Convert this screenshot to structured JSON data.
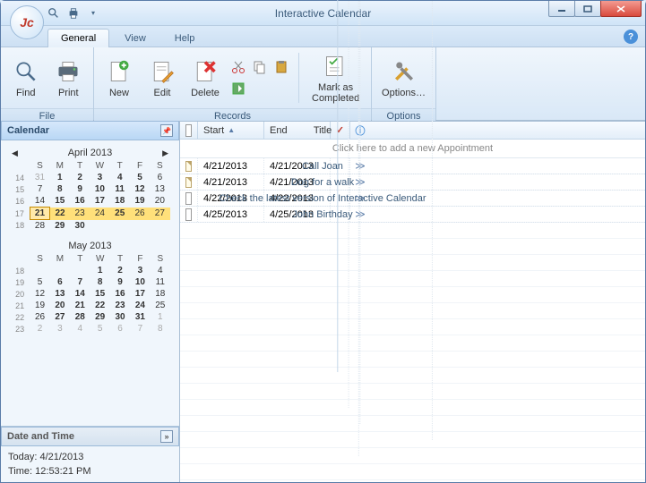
{
  "app_icon_text": "Jc",
  "window_title": "Interactive Calendar",
  "qat": {
    "search": "search-icon",
    "print": "print-icon",
    "dropdown": "chevron-down-icon"
  },
  "tabs": {
    "general": "General",
    "view": "View",
    "help": "Help"
  },
  "ribbon": {
    "file": {
      "label": "File",
      "find": "Find",
      "print": "Print"
    },
    "records": {
      "label": "Records",
      "new": "New",
      "edit": "Edit",
      "delete": "Delete",
      "mark": "Mark as\nCompleted"
    },
    "options": {
      "label": "Options",
      "options": "Options…"
    }
  },
  "left": {
    "calendar_title": "Calendar",
    "cal1": {
      "title": "April 2013",
      "dow": [
        "S",
        "M",
        "T",
        "W",
        "T",
        "F",
        "S"
      ],
      "weeks": [
        {
          "wk": "14",
          "days": [
            {
              "d": "31",
              "dim": true
            },
            {
              "d": "1",
              "bold": true
            },
            {
              "d": "2",
              "bold": true
            },
            {
              "d": "3",
              "bold": true
            },
            {
              "d": "4",
              "bold": true
            },
            {
              "d": "5",
              "bold": true
            },
            {
              "d": "6"
            }
          ]
        },
        {
          "wk": "15",
          "days": [
            {
              "d": "7"
            },
            {
              "d": "8",
              "bold": true
            },
            {
              "d": "9",
              "bold": true
            },
            {
              "d": "10",
              "bold": true
            },
            {
              "d": "11",
              "bold": true
            },
            {
              "d": "12",
              "bold": true
            },
            {
              "d": "13"
            }
          ]
        },
        {
          "wk": "16",
          "days": [
            {
              "d": "14"
            },
            {
              "d": "15",
              "bold": true
            },
            {
              "d": "16",
              "bold": true
            },
            {
              "d": "17",
              "bold": true
            },
            {
              "d": "18",
              "bold": true
            },
            {
              "d": "19",
              "bold": true
            },
            {
              "d": "20"
            }
          ]
        },
        {
          "wk": "17",
          "days": [
            {
              "d": "21",
              "today": true
            },
            {
              "d": "22",
              "sel": true,
              "bold": true
            },
            {
              "d": "23",
              "sel": true
            },
            {
              "d": "24",
              "sel": true
            },
            {
              "d": "25",
              "sel": true,
              "bold": true
            },
            {
              "d": "26",
              "sel": true
            },
            {
              "d": "27",
              "sel": true
            }
          ]
        },
        {
          "wk": "18",
          "days": [
            {
              "d": "28"
            },
            {
              "d": "29",
              "bold": true
            },
            {
              "d": "30",
              "bold": true
            },
            {
              "d": ""
            },
            {
              "d": ""
            },
            {
              "d": ""
            },
            {
              "d": ""
            }
          ]
        }
      ]
    },
    "cal2": {
      "title": "May 2013",
      "dow": [
        "S",
        "M",
        "T",
        "W",
        "T",
        "F",
        "S"
      ],
      "weeks": [
        {
          "wk": "18",
          "days": [
            {
              "d": ""
            },
            {
              "d": ""
            },
            {
              "d": ""
            },
            {
              "d": "1",
              "bold": true
            },
            {
              "d": "2",
              "bold": true
            },
            {
              "d": "3",
              "bold": true
            },
            {
              "d": "4"
            }
          ]
        },
        {
          "wk": "19",
          "days": [
            {
              "d": "5"
            },
            {
              "d": "6",
              "bold": true
            },
            {
              "d": "7",
              "bold": true
            },
            {
              "d": "8",
              "bold": true
            },
            {
              "d": "9",
              "bold": true
            },
            {
              "d": "10",
              "bold": true
            },
            {
              "d": "11"
            }
          ]
        },
        {
          "wk": "20",
          "days": [
            {
              "d": "12"
            },
            {
              "d": "13",
              "bold": true
            },
            {
              "d": "14",
              "bold": true
            },
            {
              "d": "15",
              "bold": true
            },
            {
              "d": "16",
              "bold": true
            },
            {
              "d": "17",
              "bold": true
            },
            {
              "d": "18"
            }
          ]
        },
        {
          "wk": "21",
          "days": [
            {
              "d": "19"
            },
            {
              "d": "20",
              "bold": true
            },
            {
              "d": "21",
              "bold": true
            },
            {
              "d": "22",
              "bold": true
            },
            {
              "d": "23",
              "bold": true
            },
            {
              "d": "24",
              "bold": true
            },
            {
              "d": "25"
            }
          ]
        },
        {
          "wk": "22",
          "days": [
            {
              "d": "26"
            },
            {
              "d": "27",
              "bold": true
            },
            {
              "d": "28",
              "bold": true
            },
            {
              "d": "29",
              "bold": true
            },
            {
              "d": "30",
              "bold": true
            },
            {
              "d": "31",
              "bold": true
            },
            {
              "d": "1",
              "dim": true
            }
          ]
        },
        {
          "wk": "23",
          "days": [
            {
              "d": "2",
              "dim": true
            },
            {
              "d": "3",
              "dim": true
            },
            {
              "d": "4",
              "dim": true
            },
            {
              "d": "5",
              "dim": true
            },
            {
              "d": "6",
              "dim": true
            },
            {
              "d": "7",
              "dim": true
            },
            {
              "d": "8",
              "dim": true
            }
          ]
        }
      ]
    },
    "datetime_title": "Date and Time",
    "today_label": "Today: 4/21/2013",
    "time_label": "Time: 12:53:21 PM"
  },
  "grid": {
    "col_title": "Title",
    "col_start": "Start",
    "col_end": "End",
    "add_hint": "Click here to add a new Appointment",
    "rows": [
      {
        "icon": "note",
        "title": "Call Joan",
        "start": "4/21/2013",
        "end": "4/21/2013"
      },
      {
        "icon": "note",
        "title": "Dog for a walk",
        "start": "4/21/2013",
        "end": "4/21/2013"
      },
      {
        "icon": "doc",
        "title": "Check the latest version of Interactive Calendar",
        "start": "4/22/2013",
        "end": "4/22/2013"
      },
      {
        "icon": "doc",
        "title": "John Birthday",
        "start": "4/25/2013",
        "end": "4/25/2013"
      }
    ]
  }
}
